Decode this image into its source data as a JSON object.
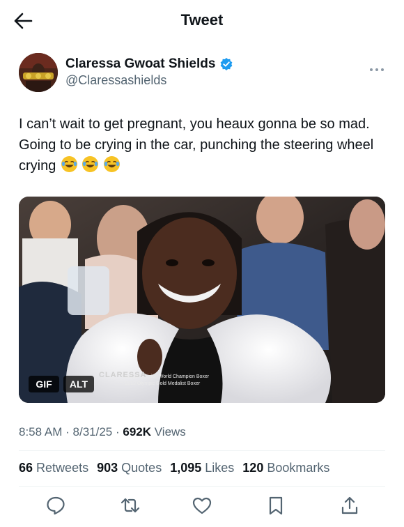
{
  "header": {
    "title": "Tweet",
    "back_icon": "back-arrow-icon"
  },
  "author": {
    "name": "Claressa Gwoat Shields",
    "handle": "@Claressashields",
    "verified_color": "#1d9bf0"
  },
  "tweet": {
    "text": "I can’t wait to get pregnant, you heaux gonna be so mad. Going to be crying in the car, punching the steering wheel crying",
    "emojis": [
      "face-with-tears-of-joy-icon",
      "face-with-tears-of-joy-icon",
      "face-with-tears-of-joy-icon"
    ]
  },
  "media": {
    "gif_label": "GIF",
    "alt_label": "ALT",
    "caption_name": "CLARESSA",
    "caption_line1": "Multiple-Division World Champion Boxer",
    "caption_line2": "• 2012 Olympic Gold Medalist Boxer"
  },
  "meta": {
    "time": "8:58 AM",
    "date": "8/31/25",
    "views_count": "692K",
    "views_label": "Views",
    "sep": "·"
  },
  "stats": {
    "retweets_count": "66",
    "retweets_label": "Retweets",
    "quotes_count": "903",
    "quotes_label": "Quotes",
    "likes_count": "1,095",
    "likes_label": "Likes",
    "bookmarks_count": "120",
    "bookmarks_label": "Bookmarks"
  },
  "actions": [
    "reply-icon",
    "retweet-icon",
    "like-icon",
    "bookmark-icon",
    "share-icon"
  ],
  "colors": {
    "accent": "#1d9bf0",
    "icon": "#536471",
    "text": "#0f1419"
  }
}
